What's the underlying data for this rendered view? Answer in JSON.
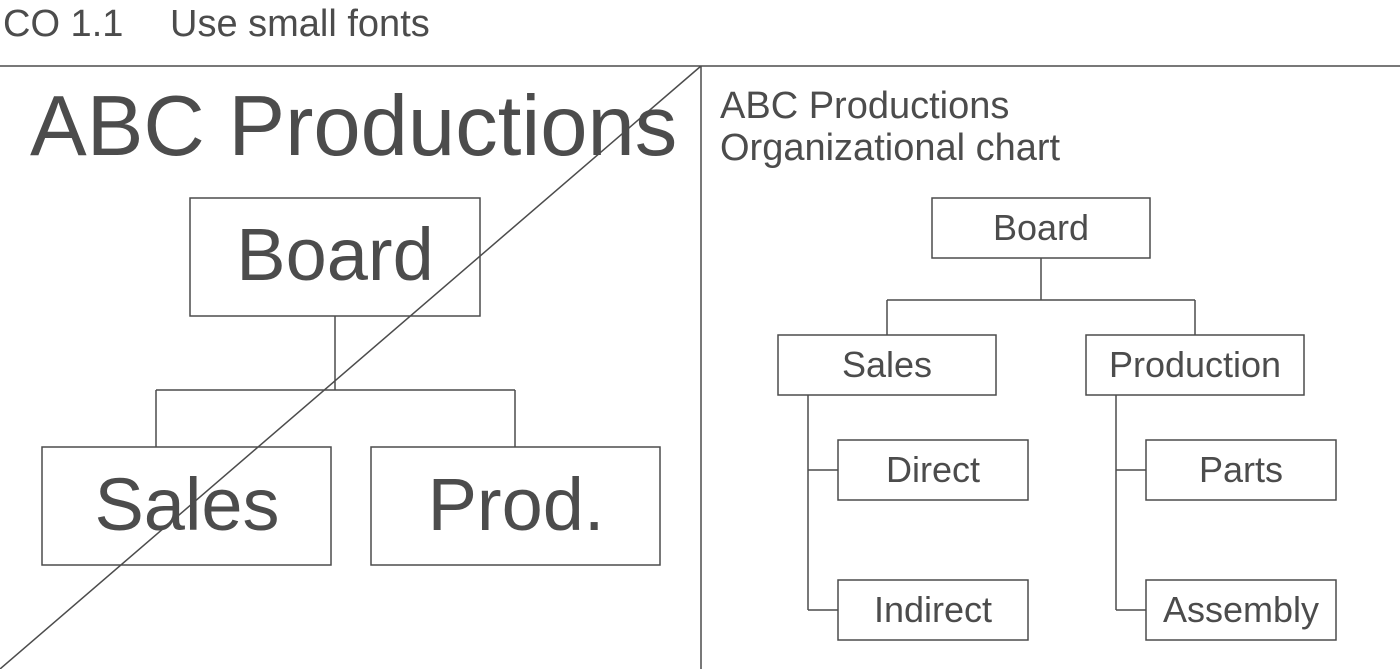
{
  "header": {
    "code": "CO 1.1",
    "title": "Use small fonts"
  },
  "left": {
    "title": "ABC Productions",
    "board": "Board",
    "sales": "Sales",
    "prod": "Prod."
  },
  "right": {
    "title1": "ABC Productions",
    "title2": "Organizational chart",
    "board": "Board",
    "sales": "Sales",
    "production": "Production",
    "direct": "Direct",
    "indirect": "Indirect",
    "parts": "Parts",
    "assembly": "Assembly"
  },
  "chart_data": {
    "type": "org-chart",
    "title": "ABC Productions — Organizational chart",
    "root": {
      "name": "Board",
      "children": [
        {
          "name": "Sales",
          "children": [
            {
              "name": "Direct"
            },
            {
              "name": "Indirect"
            }
          ]
        },
        {
          "name": "Production",
          "children": [
            {
              "name": "Parts"
            },
            {
              "name": "Assembly"
            }
          ]
        }
      ]
    },
    "bad_example": {
      "title": "ABC Productions",
      "root": {
        "name": "Board",
        "children": [
          {
            "name": "Sales"
          },
          {
            "name": "Prod."
          }
        ]
      }
    }
  }
}
